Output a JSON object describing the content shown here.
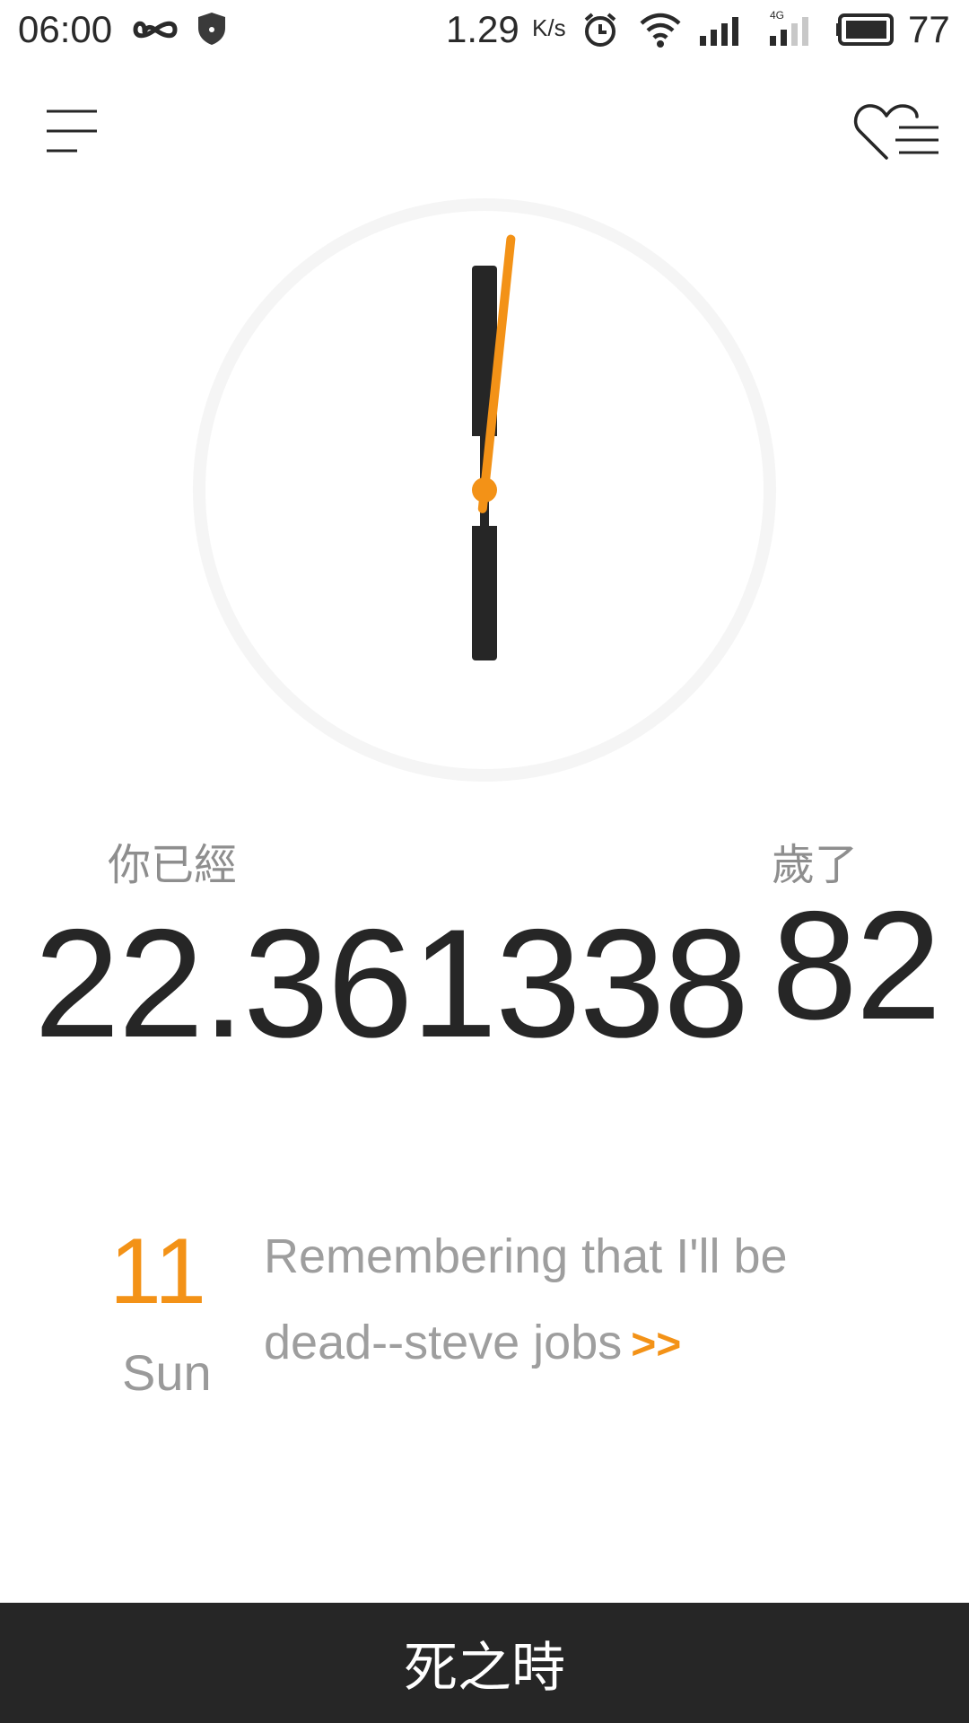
{
  "status_bar": {
    "time": "06:00",
    "net_speed": "1.29",
    "net_speed_unit": "K/s",
    "battery": "77",
    "icons": [
      "infinity-icon",
      "shield-icon",
      "alarm-icon",
      "wifi-icon",
      "signal-icon",
      "signal-4g-icon",
      "battery-icon"
    ]
  },
  "toolbar": {
    "menu_icon": "hamburger-menu-icon",
    "favorites_icon": "heart-list-icon"
  },
  "clock": {
    "hour": 6,
    "minute": 0,
    "second": 1,
    "second_hand_color": "#f39217",
    "hand_color": "#262626"
  },
  "age": {
    "prefix": "你已經",
    "value_main": "22.361338",
    "value_tail": "82",
    "suffix": "歲了"
  },
  "daily": {
    "day_number": "11",
    "weekday": "Sun",
    "quote": "Remembering that I'll be dead--steve jobs",
    "more": ">>"
  },
  "bottom_bar": {
    "title": "死之時"
  },
  "colors": {
    "accent": "#f39217",
    "text_dark": "#262626",
    "text_muted": "#9e9e9e"
  }
}
